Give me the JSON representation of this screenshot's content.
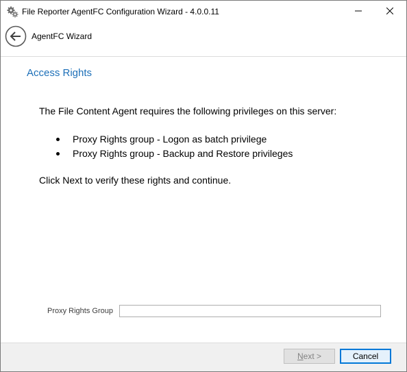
{
  "window": {
    "title": "File Reporter AgentFC Configuration Wizard - 4.0.0.11",
    "app_icon": "gears-icon",
    "controls": [
      "minimize-icon",
      "close-icon"
    ]
  },
  "header": {
    "back_icon": "back-arrow-icon",
    "wizard_title": "AgentFC Wizard"
  },
  "content": {
    "page_title": "Access Rights",
    "intro": "The File Content Agent requires the following privileges on this server:",
    "bullets": [
      "Proxy Rights group - Logon as batch privilege",
      "Proxy Rights group - Backup and Restore privileges"
    ],
    "outro": "Click Next to verify these rights and continue."
  },
  "form": {
    "proxy_group_label": "Proxy Rights Group",
    "proxy_group_value": ""
  },
  "footer": {
    "next_mnemonic": "N",
    "next_rest": "ext >",
    "cancel_label": "Cancel"
  },
  "colors": {
    "accent": "#1c6fb8",
    "focus_border": "#0078d7",
    "footer_bg": "#f0f0f0"
  }
}
